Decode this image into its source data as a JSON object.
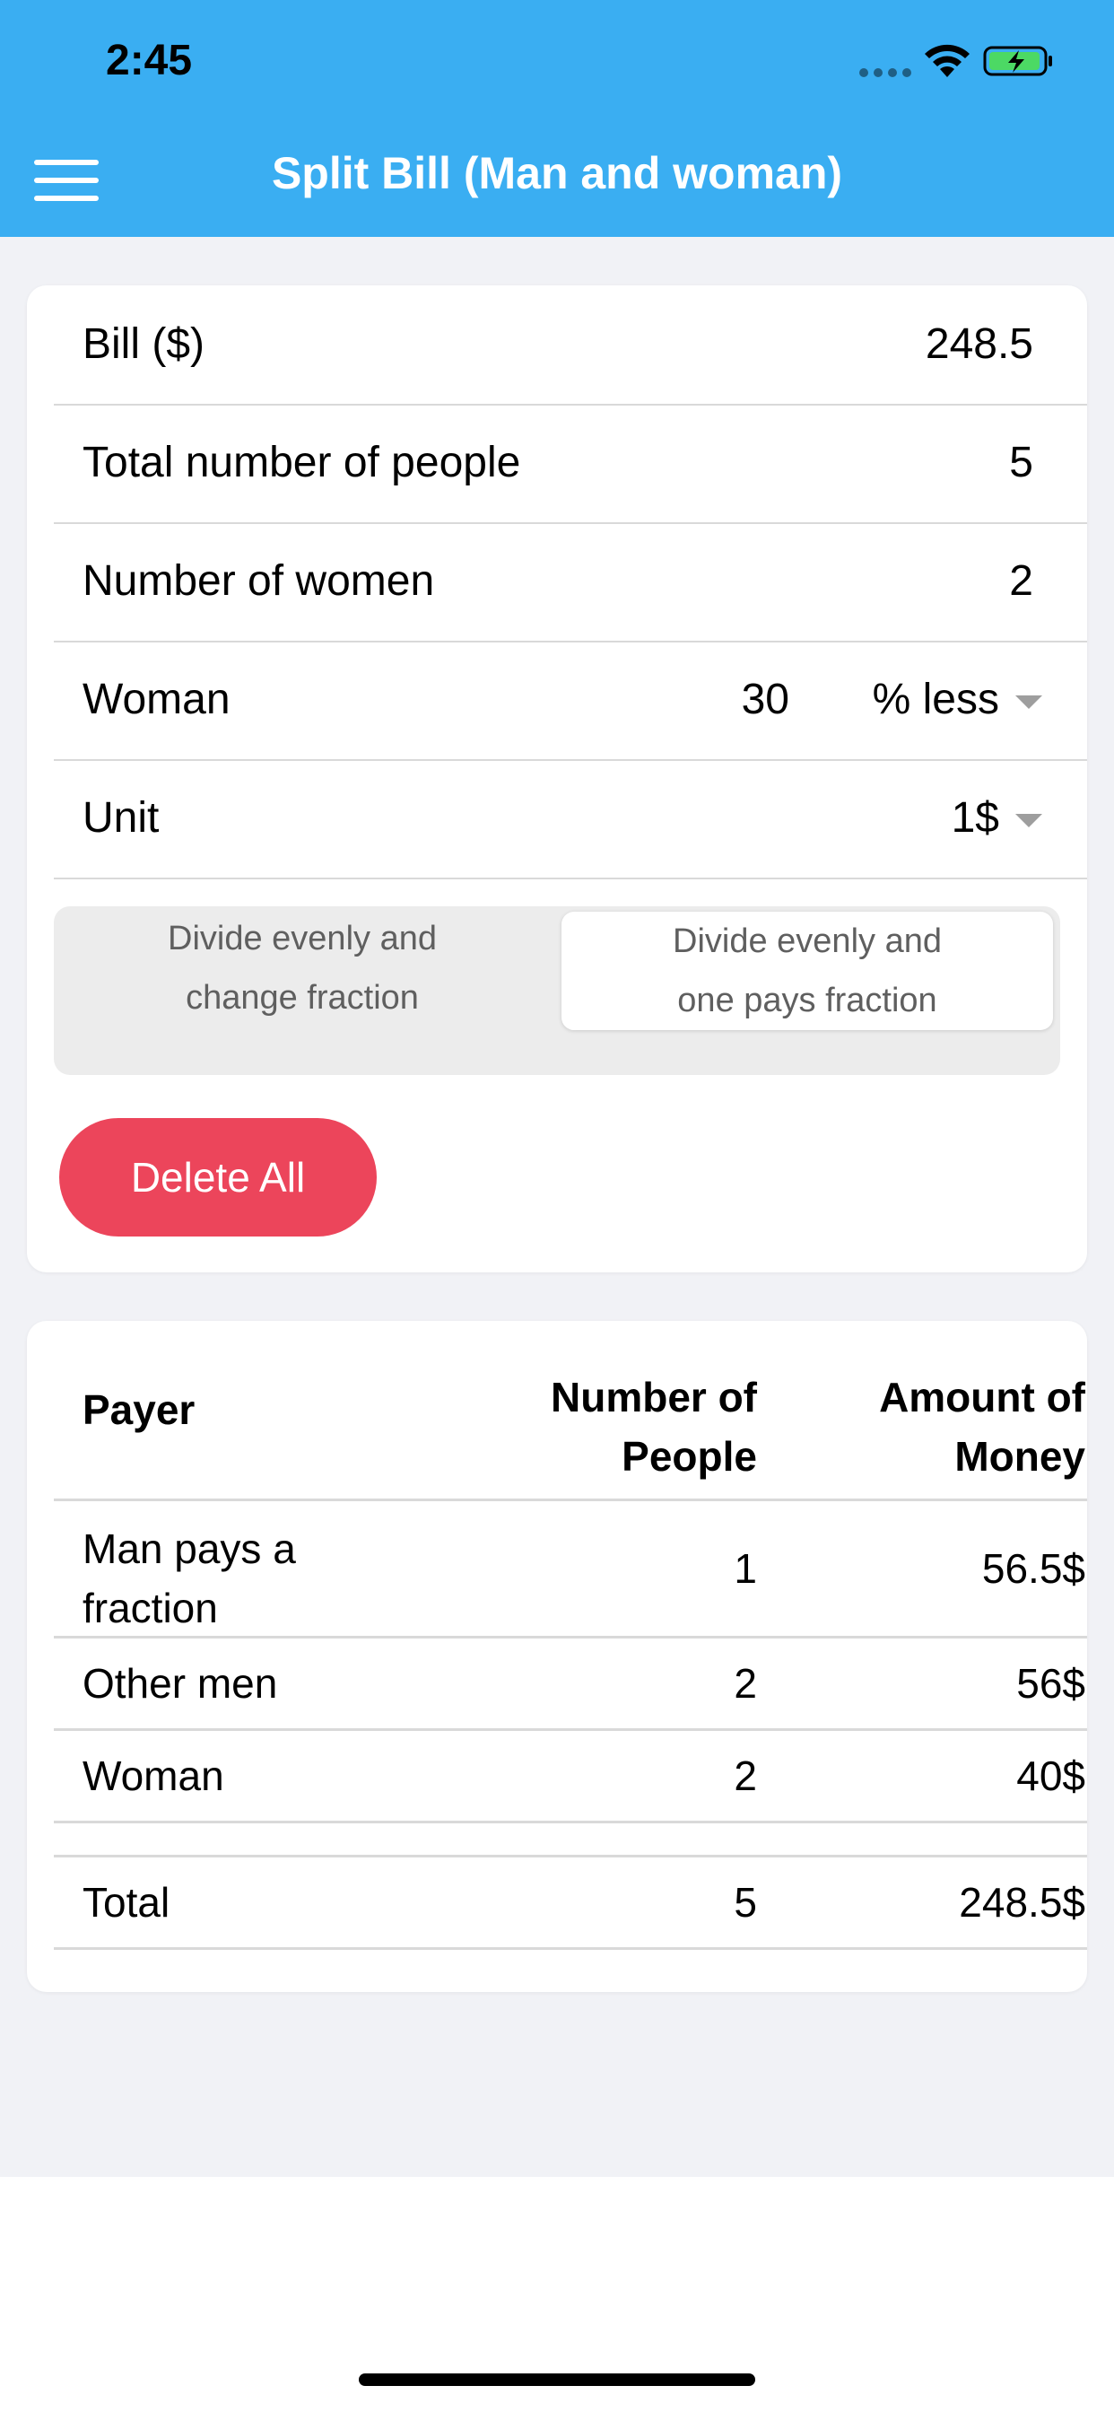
{
  "status_bar": {
    "time": "2:45"
  },
  "header": {
    "title": "Split Bill (Man and woman)",
    "menu_icon": "hamburger-menu-icon"
  },
  "inputs": {
    "bill_label": "Bill ($)",
    "bill_value": "248.5",
    "total_people_label": "Total number of people",
    "total_people_value": "5",
    "women_label": "Number of women",
    "women_value": "2",
    "woman_label": "Woman",
    "woman_value": "30",
    "woman_mode": "% less",
    "unit_label": "Unit",
    "unit_value": "1$"
  },
  "segmented": {
    "option1_line1": "Divide evenly and",
    "option1_line2": "change fraction",
    "option2_line1": "Divide evenly and",
    "option2_line2": "one pays fraction",
    "selected": 2
  },
  "actions": {
    "delete_label": "Delete All"
  },
  "table": {
    "header_payer": "Payer",
    "header_people_line1": "Number of",
    "header_people_line2": "People",
    "header_money_line1": "Amount of",
    "header_money_line2": "Money",
    "rows": [
      {
        "payer_line1": "Man pays a",
        "payer_line2": "fraction",
        "people": "1",
        "money": "56.5$"
      },
      {
        "payer": "Other men",
        "people": "2",
        "money": "56$"
      },
      {
        "payer": "Woman",
        "people": "2",
        "money": "40$"
      }
    ],
    "total": {
      "payer": "Total",
      "people": "5",
      "money": "248.5$"
    }
  },
  "colors": {
    "header_bg": "#3aaef2",
    "delete_bg": "#ec455b",
    "page_bg": "#f1f2f6"
  }
}
